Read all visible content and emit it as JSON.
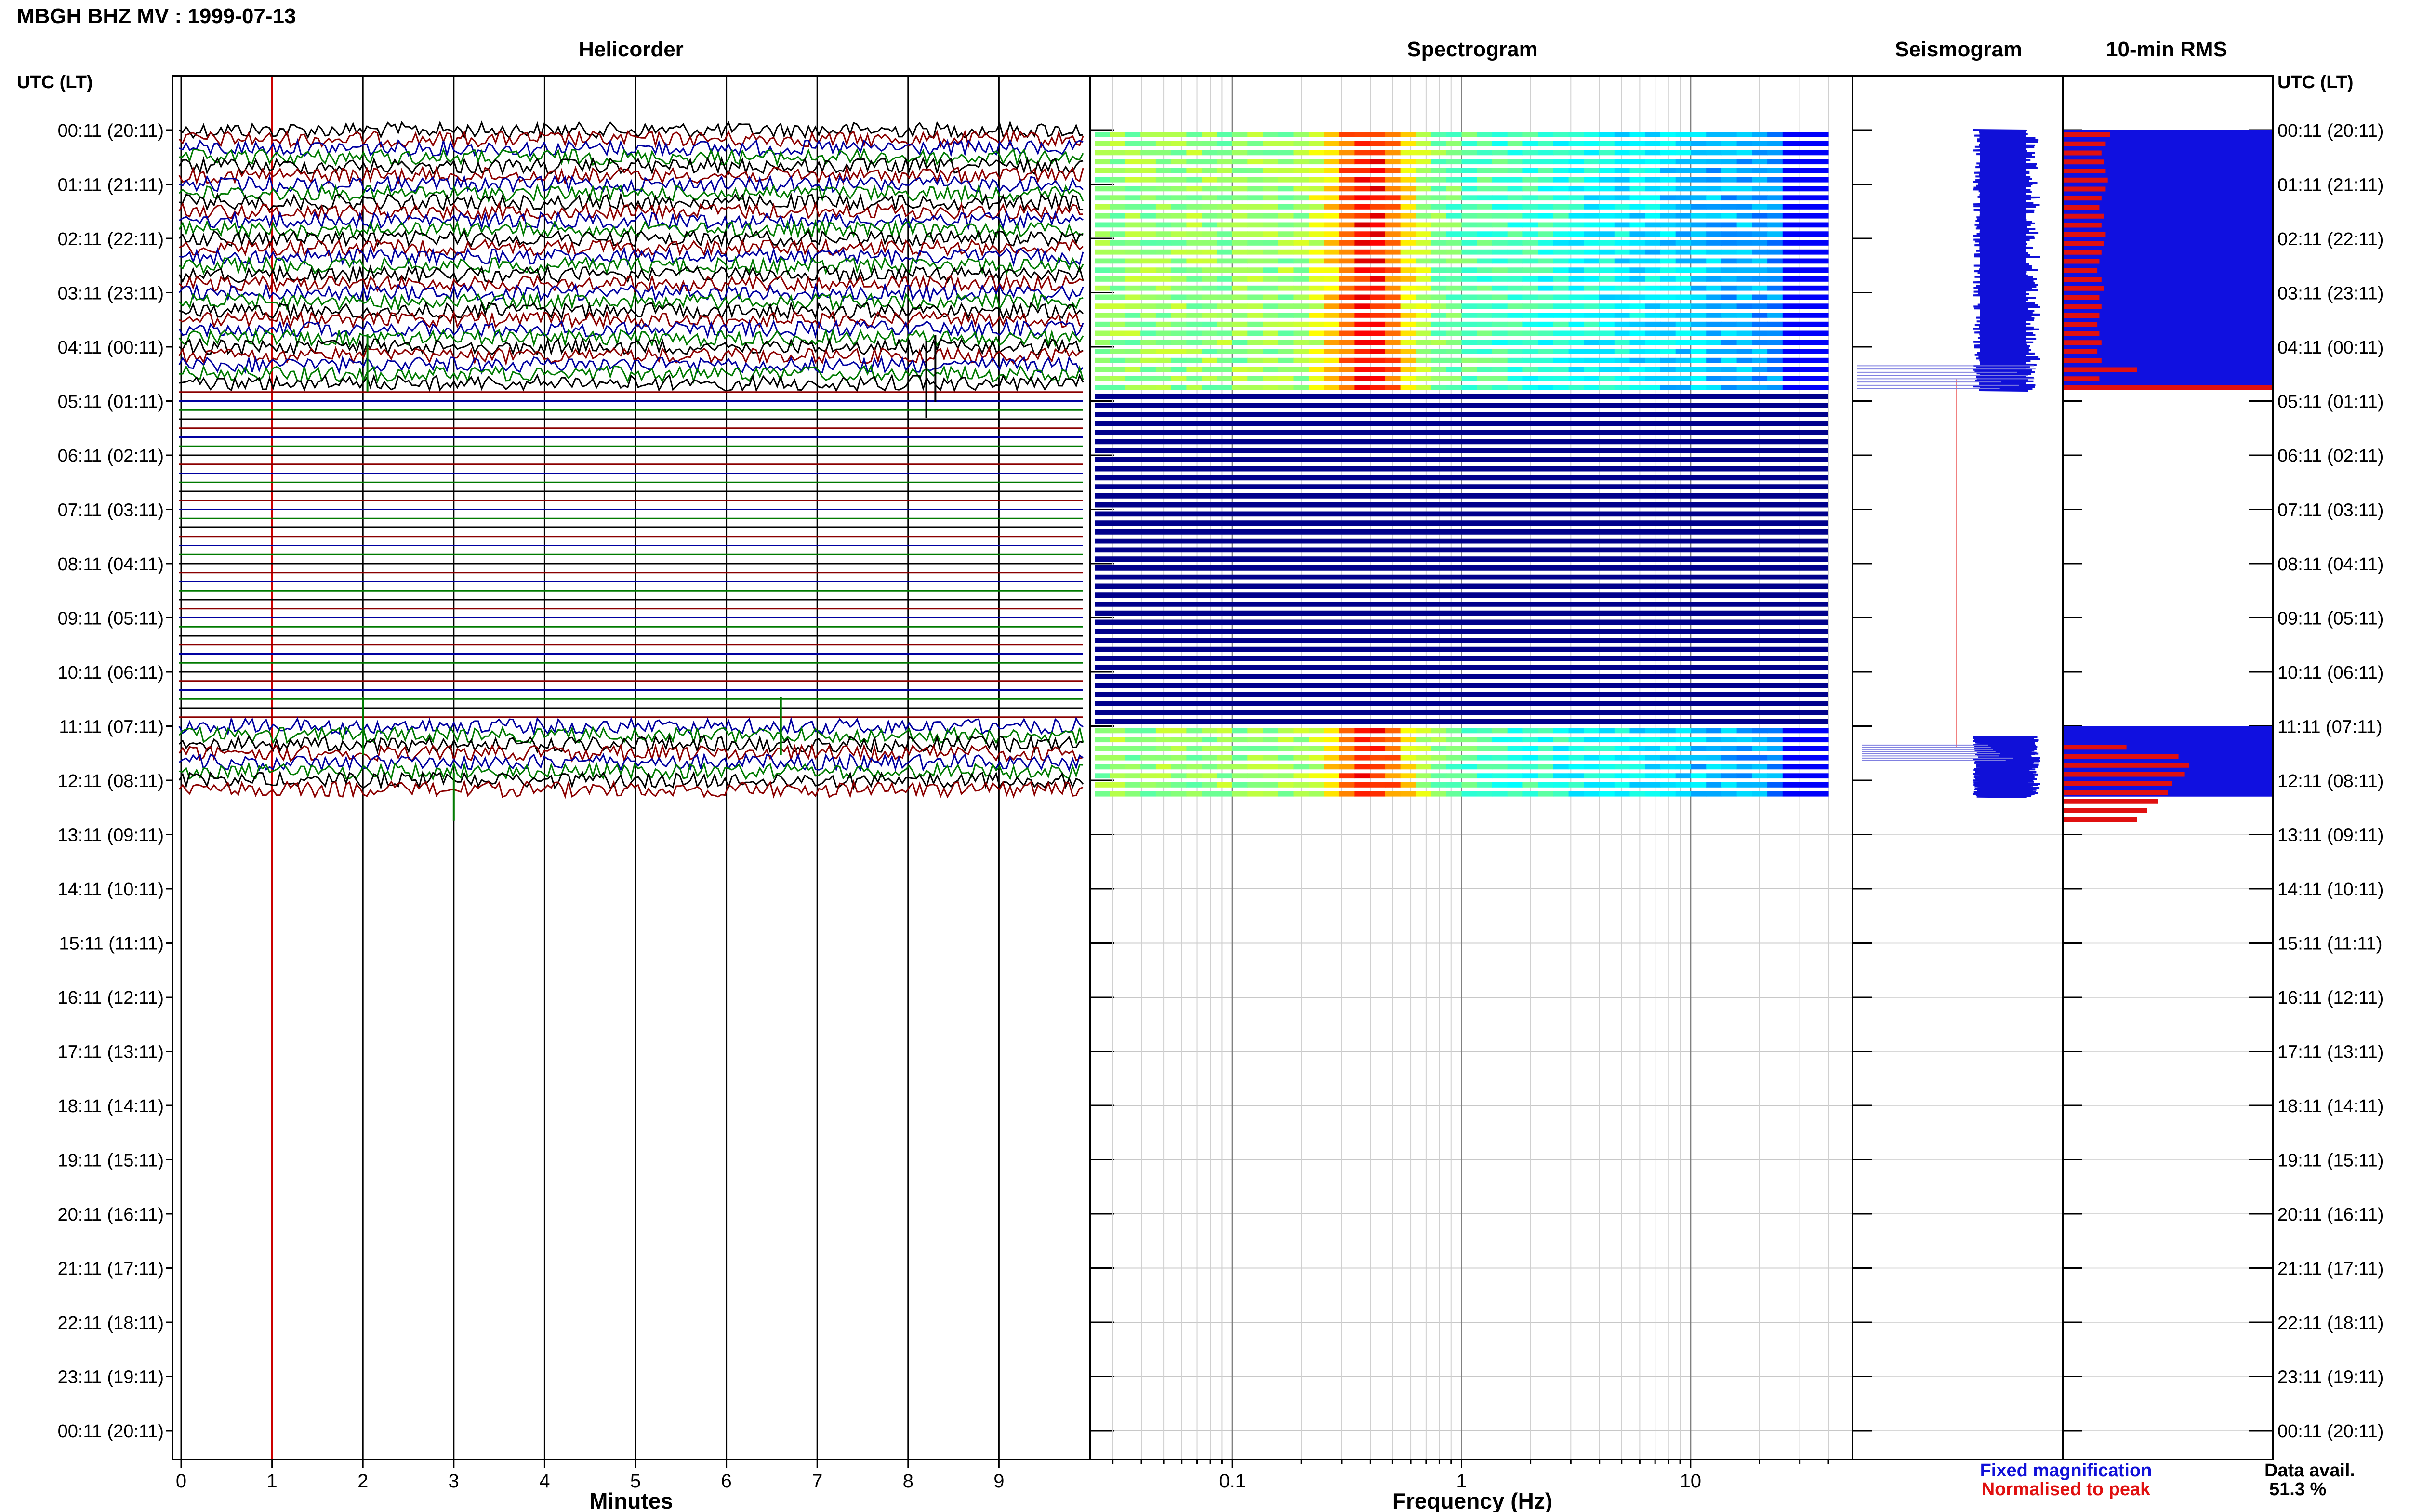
{
  "header": {
    "title": "MBGH BHZ MV : 1999-07-13",
    "utc_lt_left": "UTC (LT)",
    "utc_lt_right": "UTC (LT)"
  },
  "panels": {
    "helicorder": "Helicorder",
    "spectrogram": "Spectrogram",
    "seismogram": "Seismogram",
    "rms": "10-min RMS"
  },
  "axes": {
    "helicorder_xlabel": "Minutes",
    "helicorder_ticks": [
      "0",
      "1",
      "2",
      "3",
      "4",
      "5",
      "6",
      "7",
      "8",
      "9"
    ],
    "spectrogram_xlabel": "Frequency (Hz)",
    "spectrogram_ticks": [
      "0.1",
      "1",
      "10"
    ]
  },
  "time_labels": [
    "00:11 (20:11)",
    "01:11 (21:11)",
    "02:11 (22:11)",
    "03:11 (23:11)",
    "04:11 (00:11)",
    "05:11 (01:11)",
    "06:11 (02:11)",
    "07:11 (03:11)",
    "08:11 (04:11)",
    "09:11 (05:11)",
    "10:11 (06:11)",
    "11:11 (07:11)",
    "12:11 (08:11)",
    "13:11 (09:11)",
    "14:11 (10:11)",
    "15:11 (11:11)",
    "16:11 (12:11)",
    "17:11 (13:11)",
    "18:11 (14:11)",
    "19:11 (15:11)",
    "20:11 (16:11)",
    "21:11 (17:11)",
    "22:11 (18:11)",
    "23:11 (19:11)",
    "00:11 (20:11)"
  ],
  "legend": {
    "fixed": "Fixed magnification",
    "normalised": "Normalised to peak",
    "fixed_color": "#1010d8",
    "normalised_color": "#e01010"
  },
  "availability": {
    "label": "Data avail.",
    "value": "51.3 %"
  },
  "colors": {
    "trace_cycle": [
      "#000000",
      "#8b0000",
      "#0000a0",
      "#007a00"
    ],
    "red_marker": "#cc0000",
    "spec_dark": "#00008b",
    "rms_fill": "#1010e0",
    "rms_bar": "#e01010"
  },
  "chart_data": [
    {
      "type": "line",
      "title": "Helicorder",
      "xlabel": "Minutes",
      "xlim": [
        0,
        10
      ],
      "x_ticks": [
        0,
        1,
        2,
        3,
        4,
        5,
        6,
        7,
        8,
        9
      ],
      "marker_minute": 1,
      "data_segments_hours": [
        [
          0,
          4.8
        ],
        [
          11.0,
          12.3
        ]
      ],
      "flat_segments_hours": [
        [
          4.8,
          11.0
        ]
      ]
    },
    {
      "type": "heatmap",
      "title": "Spectrogram",
      "xlabel": "Frequency (Hz)",
      "xscale": "log",
      "xlim": [
        0.025,
        40
      ],
      "x_ticks": [
        0.1,
        1,
        10
      ],
      "peak_band_hz": [
        0.3,
        0.5
      ],
      "data_segments_hours": [
        [
          0,
          4.8
        ],
        [
          11.0,
          12.3
        ]
      ],
      "flat_segments_hours": [
        [
          4.8,
          11.0
        ]
      ]
    },
    {
      "type": "line",
      "title": "Seismogram",
      "series": [
        {
          "name": "Fixed magnification"
        },
        {
          "name": "Normalised to peak"
        }
      ]
    },
    {
      "type": "bar",
      "title": "10-min RMS",
      "active_hours": [
        [
          0,
          4.8
        ],
        [
          11.0,
          12.3
        ]
      ],
      "relative_rms_6_per_hour": [
        0.22,
        0.2,
        0.18,
        0.19,
        0.2,
        0.21,
        0.2,
        0.18,
        0.17,
        0.19,
        0.18,
        0.2,
        0.19,
        0.18,
        0.17,
        0.16,
        0.18,
        0.19,
        0.17,
        0.18,
        0.17,
        0.16,
        0.17,
        0.18,
        0.16,
        0.18,
        0.35,
        0.17,
        1.0,
        0.3,
        0.55,
        0.6,
        0.58,
        0.52,
        0.5,
        0.45,
        0.4,
        0.35
      ]
    }
  ]
}
